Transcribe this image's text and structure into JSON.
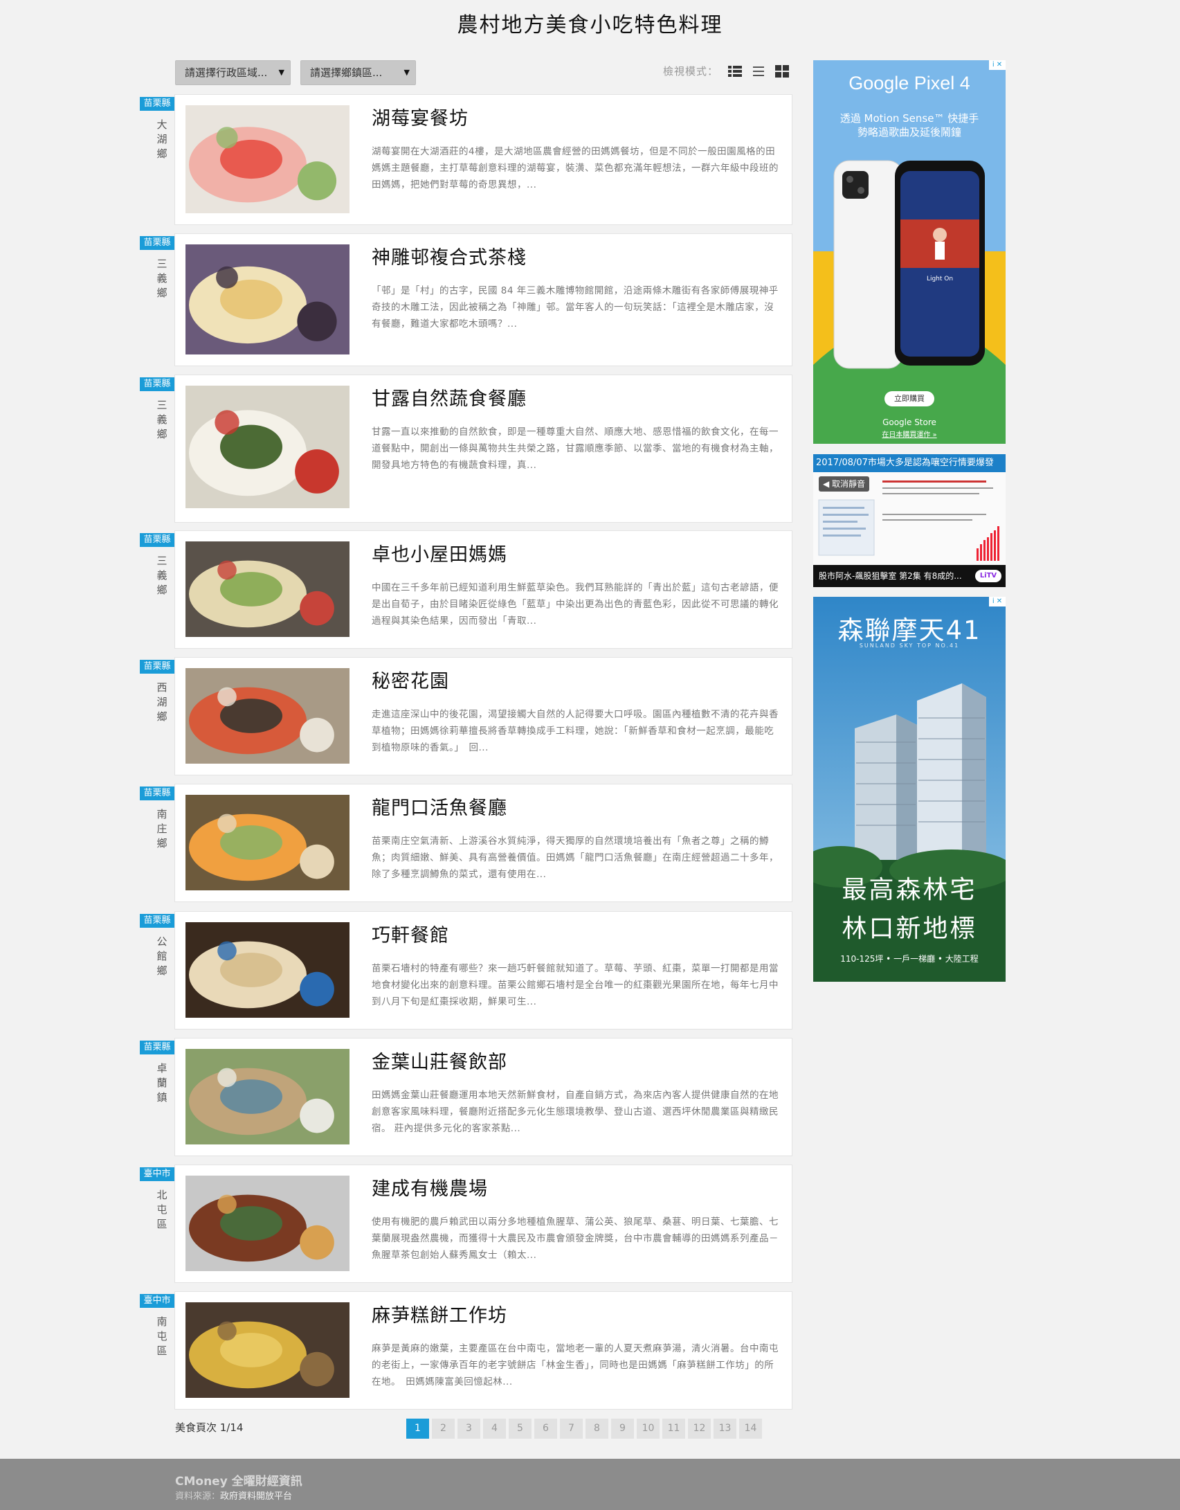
{
  "page_title": "農村地方美食小吃特色料理",
  "filters": {
    "region_placeholder": "請選擇行政區域...",
    "township_placeholder": "請選擇鄉鎮區..."
  },
  "view_mode": {
    "label": "檢視模式：",
    "options": [
      "detail-view",
      "list-view",
      "grid-view"
    ],
    "selected": "detail-view"
  },
  "accent_color": "#1a9cd8",
  "items": [
    {
      "county": "苗栗縣",
      "town": "大湖鄉",
      "name": "湖莓宴餐坊",
      "desc": "湖莓宴開在大湖酒莊的4樓，是大湖地區農會經營的田媽媽餐坊，但是不同於一般田園風格的田媽媽主題餐廳，主打草莓創意料理的湖莓宴，裝潢、菜色都充滿年輕想法，一群六年級中段班的田媽媽，把她們對草莓的奇思異想，..."
    },
    {
      "county": "苗栗縣",
      "town": "三義鄉",
      "name": "神雕邨複合式茶棧",
      "desc": "「邨」是「村」的古字，民國 84 年三義木雕博物館開館，沿途兩條木雕街有各家師傅展現神乎奇技的木雕工法，因此被稱之為「神雕」邨。當年客人的一句玩笑話：「這裡全是木雕店家，沒有餐廳，難道大家都吃木頭嗎？..."
    },
    {
      "county": "苗栗縣",
      "town": "三義鄉",
      "name": "甘露自然蔬食餐廳",
      "desc": "甘露一直以來推動的自然飲食，即是一種尊重大自然、順應大地、感恩惜福的飲食文化，在每一道餐點中，開創出一條與萬物共生共榮之路，甘露順應季節、以當季、當地的有機食材為主軸，開發具地方特色的有機蔬食料理，真..."
    },
    {
      "county": "苗栗縣",
      "town": "三義鄉",
      "name": "卓也小屋田媽媽",
      "desc": "中國在三千多年前已經知道利用生鮮藍草染色。我們耳熟能詳的「青出於藍」這句古老諺語，便是出自荀子，由於目睹染匠從綠色「藍草」中染出更為出色的青藍色彩，因此從不可思議的轉化過程與其染色結果，因而發出「青取..."
    },
    {
      "county": "苗栗縣",
      "town": "西湖鄉",
      "name": "秘密花園",
      "desc": "走進這座深山中的後花園，渴望接觸大自然的人記得要大口呼吸。園區內種植數不清的花卉與香草植物；田媽媽徐莉華擅長將香草轉換成手工料理，她說：「新鮮香草和食材一起烹調，最能吃到植物原味的香氣。」　回..."
    },
    {
      "county": "苗栗縣",
      "town": "南庄鄉",
      "name": "龍門口活魚餐廳",
      "desc": "苗栗南庄空氣清新、上游溪谷水質純淨，得天獨厚的自然環境培養出有「魚者之尊」之稱的鱒魚；肉質細嫩、鮮美、具有高營養價值。田媽媽「龍門口活魚餐廳」在南庄經營超過二十多年，除了多種烹調鱒魚的菜式，還有使用在..."
    },
    {
      "county": "苗栗縣",
      "town": "公館鄉",
      "name": "巧軒餐館",
      "desc": "苗栗石墻村的特產有哪些？來一趟巧軒餐館就知道了。草莓、芋頭、紅棗，菜單一打開都是用當地食材變化出來的創意料理。苗栗公館鄉石墻村是全台唯一的紅棗觀光果園所在地，每年七月中到八月下旬是紅棗採收期，鮮果可生..."
    },
    {
      "county": "苗栗縣",
      "town": "卓蘭鎮",
      "name": "金葉山莊餐飲部",
      "desc": "田媽媽金葉山莊餐廳運用本地天然新鮮食材，自產自銷方式，為來店內客人提供健康自然的在地創意客家風味料理，餐廳附近搭配多元化生態環境教學、登山古道、選西坪休閒農業區與精緻民宿。 莊內提供多元化的客家茶點..."
    },
    {
      "county": "臺中市",
      "town": "北屯區",
      "name": "建成有機農場",
      "desc": "使用有機肥的農戶賴武田以兩分多地種植魚腥草、蒲公英、狼尾草、桑葚、明日葉、七葉膽、七葉蘭展現盎然農機，而獲得十大農民及市農會頒發金牌獎，台中市農會輔導的田媽媽系列產品－魚腥草茶包創始人蘇秀鳳女士（賴太..."
    },
    {
      "county": "臺中市",
      "town": "南屯區",
      "name": "麻芛糕餅工作坊",
      "desc": "麻芛是黃麻的嫩葉，主要產區在台中南屯，當地老一輩的人夏天煮麻芛湯，清火消暑。台中南屯的老街上，一家傳承百年的老字號餅店「林金生香」，同時也是田媽媽「麻芛糕餅工作坊」的所在地。　田媽媽陳富美回憶起林..."
    }
  ],
  "pagination": {
    "label": "美食頁次 1/14",
    "pages": [
      "1",
      "2",
      "3",
      "4",
      "5",
      "6",
      "7",
      "8",
      "9",
      "10",
      "11",
      "12",
      "13",
      "14"
    ],
    "current": "1"
  },
  "ads": {
    "pixel": {
      "title": "Google Pixel 4",
      "subtitle": "透過 Motion Sense™ 快捷手勢略過歌曲及延後鬧鐘",
      "song": "Light On",
      "cta": "立即購買",
      "store": "Google Store",
      "store_link": "在日本購買運作 »"
    },
    "video": {
      "headline": "2017/08/07市場大多是認為嚷空行情要爆發",
      "mute": "◀ 取消靜音",
      "caption": "股市阿水-飆股狙擊室 第2集 有8成的...",
      "logo": "LiTV"
    },
    "realestate": {
      "title": "森聯摩天41",
      "subtitle": "SUNLAND SKY TOP NO.41",
      "line1": "最高森林宅",
      "line2": "林口新地標",
      "specs": "110-125坪 • 一戶一梯廳 • 大陸工程"
    },
    "badge": "i ✕"
  },
  "footer": {
    "brand": "CMoney 全曜財經資訊",
    "source_label": "資料來源：",
    "source_value": "政府資料開放平台"
  }
}
